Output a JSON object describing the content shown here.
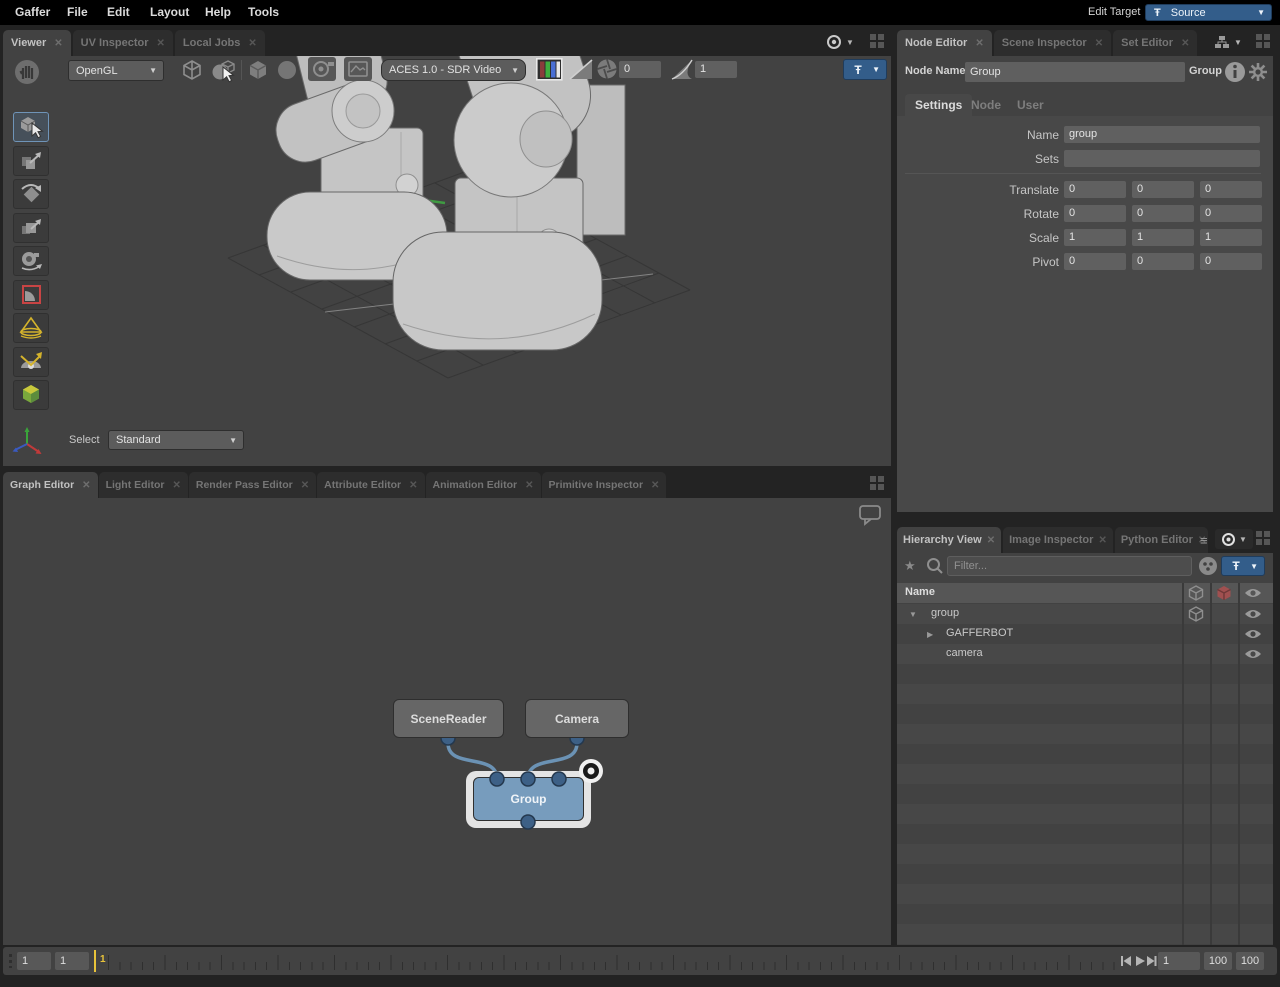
{
  "menubar": {
    "items": [
      "Gaffer",
      "File",
      "Edit",
      "Layout",
      "Help",
      "Tools"
    ],
    "edit_target_label": "Edit Target",
    "edit_target_value": "Source"
  },
  "viewer": {
    "tabs": [
      {
        "label": "Viewer"
      },
      {
        "label": "UV Inspector"
      },
      {
        "label": "Local Jobs"
      }
    ],
    "renderer": "OpenGL",
    "display_transform": "ACES 1.0 - SDR Video",
    "exposure": "0",
    "gamma": "1",
    "select_label": "Select",
    "select_value": "Standard"
  },
  "graph_editor": {
    "tabs": [
      {
        "label": "Graph Editor"
      },
      {
        "label": "Light Editor"
      },
      {
        "label": "Render Pass Editor"
      },
      {
        "label": "Attribute Editor"
      },
      {
        "label": "Animation Editor"
      },
      {
        "label": "Primitive Inspector"
      }
    ],
    "nodes": {
      "scene_reader": "SceneReader",
      "camera": "Camera",
      "group": "Group"
    }
  },
  "node_editor": {
    "tabs": [
      {
        "label": "Node Editor"
      },
      {
        "label": "Scene Inspector"
      },
      {
        "label": "Set Editor"
      }
    ],
    "node_name_label": "Node Name",
    "node_name_value": "Group",
    "node_type": "Group",
    "subtabs": [
      {
        "label": "Settings"
      },
      {
        "label": "Node"
      },
      {
        "label": "User"
      }
    ],
    "rows": {
      "name_label": "Name",
      "name_value": "group",
      "sets_label": "Sets",
      "sets_value": "",
      "translate": {
        "label": "Translate",
        "x": "0",
        "y": "0",
        "z": "0"
      },
      "rotate": {
        "label": "Rotate",
        "x": "0",
        "y": "0",
        "z": "0"
      },
      "scale": {
        "label": "Scale",
        "x": "1",
        "y": "1",
        "z": "1"
      },
      "pivot": {
        "label": "Pivot",
        "x": "0",
        "y": "0",
        "z": "0"
      }
    }
  },
  "hierarchy": {
    "tabs": [
      {
        "label": "Hierarchy View"
      },
      {
        "label": "Image Inspector"
      },
      {
        "label": "Python Editor"
      }
    ],
    "filter_placeholder": "Filter...",
    "name_header": "Name",
    "rows": [
      {
        "label": "group"
      },
      {
        "label": "GAFFERBOT"
      },
      {
        "label": "camera"
      }
    ]
  },
  "timeline": {
    "field1": "1",
    "field2": "1",
    "playhead": "1",
    "current": "1",
    "end": "100",
    "range_end": "100"
  },
  "icons": {
    "close": "✕",
    "arrow": "▼",
    "star": "★",
    "hamburger": "≡",
    "collapsed": "▶",
    "expanded": "▼",
    "pin": "Ŧ",
    "info": "i"
  },
  "colors": {
    "accent_blue": "#335d8a",
    "node_blue": "#779cbd",
    "playhead_yellow": "#e8c33a"
  }
}
